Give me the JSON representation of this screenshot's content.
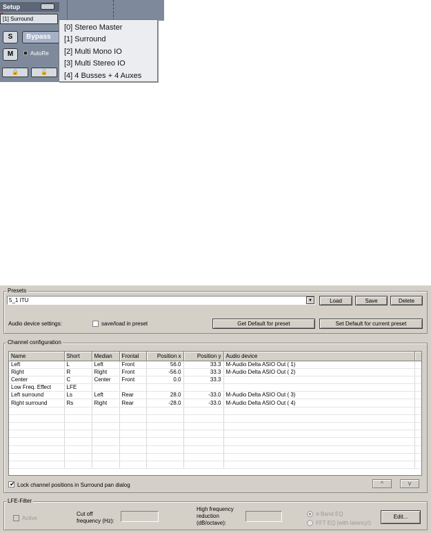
{
  "mixer": {
    "setup_label": "Setup",
    "routing_value": "[1] Surround",
    "solo_label": "S",
    "bypass_label": "Bypass",
    "mute_label": "M",
    "auto_label": "AutoRe",
    "popup_items": [
      "[0] Stereo Master",
      "[1] Surround",
      "[2] Multi Mono IO",
      "[3] Multi Stereo IO",
      "[4] 4 Busses + 4 Auxes"
    ]
  },
  "presets": {
    "title": "Presets",
    "value": "5_1 ITU",
    "load": "Load",
    "save": "Save",
    "delete": "Delete",
    "audio_settings_label": "Audio device settings:",
    "save_load_label": "save/load in preset",
    "get_default": "Get Default for preset",
    "set_default": "Set Default for current preset"
  },
  "channels": {
    "title": "Channel configuration",
    "columns": [
      "Name",
      "Short",
      "Median",
      "Frontal",
      "Position x",
      "Position y",
      "Audio device"
    ],
    "rows": [
      {
        "name": "Left",
        "short": "L",
        "median": "Left",
        "frontal": "Front",
        "px": "56.0",
        "py": "33.3",
        "device": "M-Audio Delta ASIO Out ( 1)"
      },
      {
        "name": "Right",
        "short": "R",
        "median": "Right",
        "frontal": "Front",
        "px": "-56.0",
        "py": "33.3",
        "device": "M-Audio Delta ASIO Out ( 2)"
      },
      {
        "name": "Center",
        "short": "C",
        "median": "Center",
        "frontal": "Front",
        "px": "0.0",
        "py": "33.3",
        "device": ""
      },
      {
        "name": "Low Freq. Effect",
        "short": "LFE",
        "median": "",
        "frontal": "",
        "px": "",
        "py": "",
        "device": ""
      },
      {
        "name": "Left surround",
        "short": "Ls",
        "median": "Left",
        "frontal": "Rear",
        "px": "28.0",
        "py": "-33.0",
        "device": "M-Audio Delta ASIO Out ( 3)"
      },
      {
        "name": "Right surround",
        "short": "Rs",
        "median": "Right",
        "frontal": "Rear",
        "px": "-28.0",
        "py": "-33.0",
        "device": "M-Audio Delta ASIO Out ( 4)"
      }
    ],
    "lock_label": "Lock channel positions in Surround pan dialog",
    "up_glyph": "^",
    "down_glyph": "v"
  },
  "lfe": {
    "title": "LFE-Filter",
    "active_label": "Active",
    "cutoff_label_1": "Cut off",
    "cutoff_label_2": "frequency (Hz):",
    "hf_label_1": "High frequency",
    "hf_label_2": "reduction",
    "hf_label_3": "(dB/octave):",
    "eq4_label": "4-Band EQ",
    "fft_label": "FFT EQ (with latency!)",
    "edit_label": "Edit..."
  }
}
